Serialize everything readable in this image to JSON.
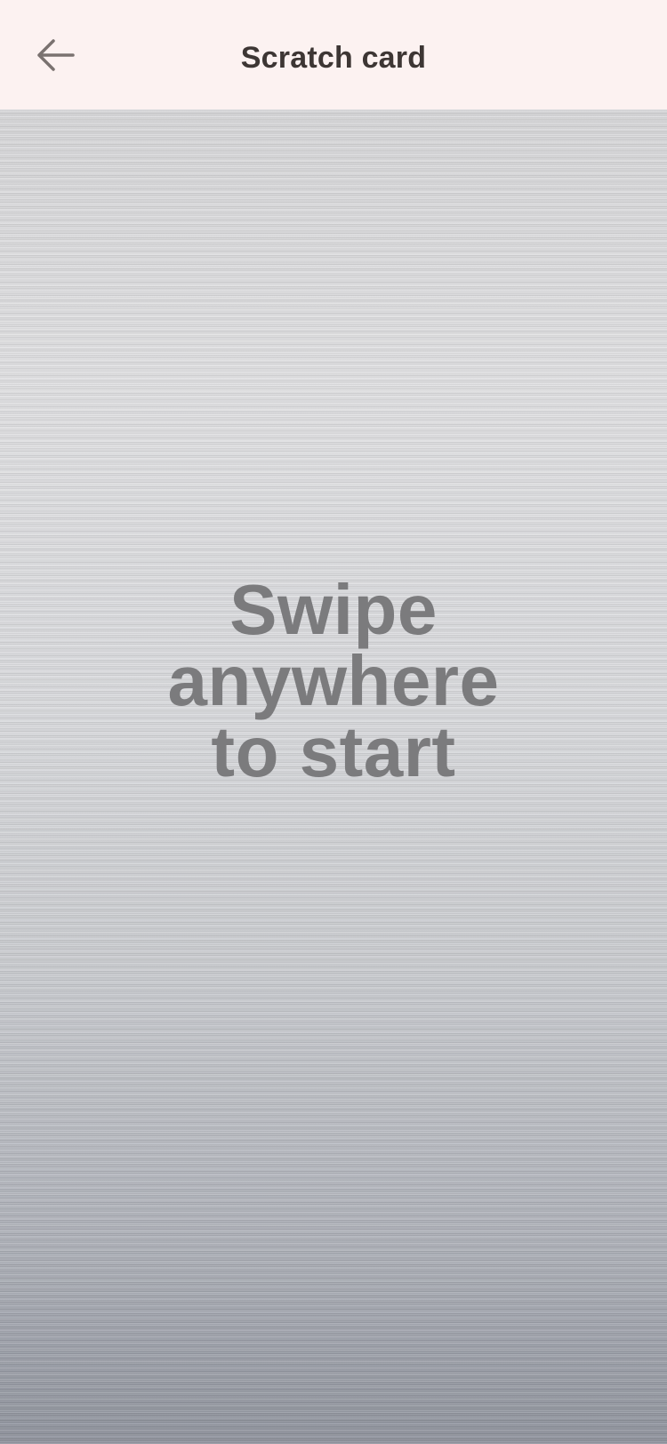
{
  "header": {
    "title": "Scratch card",
    "back_icon": "arrow-left-icon"
  },
  "scratch": {
    "prompt_lines": [
      "Swipe",
      "anywhere",
      "to start"
    ]
  },
  "colors": {
    "header_bg": "#fcf2f1",
    "title": "#3d3634",
    "prompt": "#7b7b7d"
  }
}
